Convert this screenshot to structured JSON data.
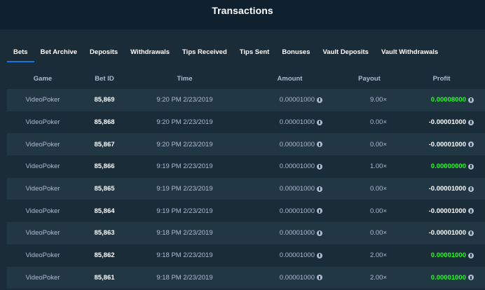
{
  "header": {
    "title": "Transactions"
  },
  "tabs": [
    {
      "label": "Bets",
      "active": true
    },
    {
      "label": "Bet Archive",
      "active": false
    },
    {
      "label": "Deposits",
      "active": false
    },
    {
      "label": "Withdrawals",
      "active": false
    },
    {
      "label": "Tips Received",
      "active": false
    },
    {
      "label": "Tips Sent",
      "active": false
    },
    {
      "label": "Bonuses",
      "active": false
    },
    {
      "label": "Vault Deposits",
      "active": false
    },
    {
      "label": "Vault Withdrawals",
      "active": false
    }
  ],
  "table": {
    "columns": [
      "Game",
      "Bet ID",
      "Time",
      "Amount",
      "Payout",
      "Profit"
    ],
    "rows": [
      {
        "game": "VideoPoker",
        "bet_id": "85,869",
        "time": "9:20 PM 2/23/2019",
        "amount": "0.00001000",
        "payout": "9.00×",
        "profit": "0.00008000",
        "profit_status": "win"
      },
      {
        "game": "VideoPoker",
        "bet_id": "85,868",
        "time": "9:20 PM 2/23/2019",
        "amount": "0.00001000",
        "payout": "0.00×",
        "profit": "-0.00001000",
        "profit_status": "loss"
      },
      {
        "game": "VideoPoker",
        "bet_id": "85,867",
        "time": "9:20 PM 2/23/2019",
        "amount": "0.00001000",
        "payout": "0.00×",
        "profit": "-0.00001000",
        "profit_status": "loss"
      },
      {
        "game": "VideoPoker",
        "bet_id": "85,866",
        "time": "9:19 PM 2/23/2019",
        "amount": "0.00001000",
        "payout": "1.00×",
        "profit": "0.00000000",
        "profit_status": "win"
      },
      {
        "game": "VideoPoker",
        "bet_id": "85,865",
        "time": "9:19 PM 2/23/2019",
        "amount": "0.00001000",
        "payout": "0.00×",
        "profit": "-0.00001000",
        "profit_status": "loss"
      },
      {
        "game": "VideoPoker",
        "bet_id": "85,864",
        "time": "9:19 PM 2/23/2019",
        "amount": "0.00001000",
        "payout": "0.00×",
        "profit": "-0.00001000",
        "profit_status": "loss"
      },
      {
        "game": "VideoPoker",
        "bet_id": "85,863",
        "time": "9:18 PM 2/23/2019",
        "amount": "0.00001000",
        "payout": "0.00×",
        "profit": "-0.00001000",
        "profit_status": "loss"
      },
      {
        "game": "VideoPoker",
        "bet_id": "85,862",
        "time": "9:18 PM 2/23/2019",
        "amount": "0.00001000",
        "payout": "2.00×",
        "profit": "0.00001000",
        "profit_status": "win"
      },
      {
        "game": "VideoPoker",
        "bet_id": "85,861",
        "time": "9:18 PM 2/23/2019",
        "amount": "0.00001000",
        "payout": "2.00×",
        "profit": "0.00001000",
        "profit_status": "win"
      }
    ]
  },
  "colors": {
    "background": "#0f212e",
    "panel": "#1a2c38",
    "row_alt": "#213743",
    "accent": "#1475e1",
    "win": "#1fff20",
    "text_muted": "#b1bad3",
    "text": "#ffffff"
  },
  "icons": {
    "currency": "coin-icon"
  }
}
